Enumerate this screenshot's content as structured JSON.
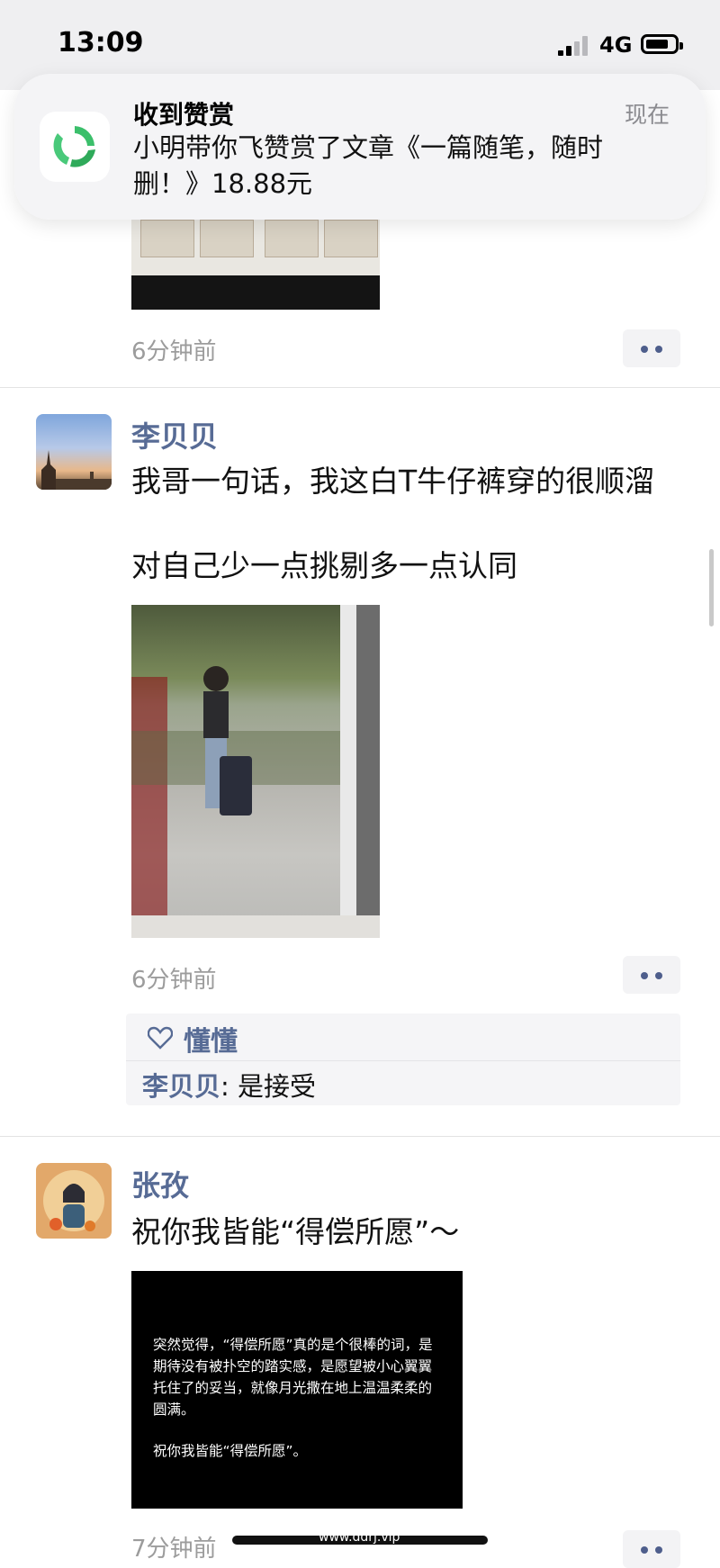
{
  "status_bar": {
    "time": "13:09",
    "network": "4G"
  },
  "notification": {
    "title": "收到赞赏",
    "time": "现在",
    "body": "小明带你飞赞赏了文章《一篇随笔，随时删！》18.88元"
  },
  "feed": {
    "post0": {
      "time": "6分钟前"
    },
    "post1": {
      "author": "李贝贝",
      "text_line1": "我哥一句话，我这白T牛仔裤穿的很顺溜",
      "text_line2": "对自己少一点挑剔多一点认同",
      "time": "6分钟前",
      "likes": "懂懂",
      "comment_author": "李贝贝",
      "comment_text": ": 是接受"
    },
    "post2": {
      "author": "张孜",
      "text": "祝你我皆能“得偿所愿”～",
      "image_text": "突然觉得，“得偿所愿”真的是个很棒的词，是期待没有被扑空的踏实感，是愿望被小心翼翼托住了的妥当，就像月光撒在地上温温柔柔的圆满。",
      "image_sign": "祝你我皆能“得偿所愿”。",
      "time": "7分钟前"
    }
  },
  "watermark": "www.ddrj.vip"
}
